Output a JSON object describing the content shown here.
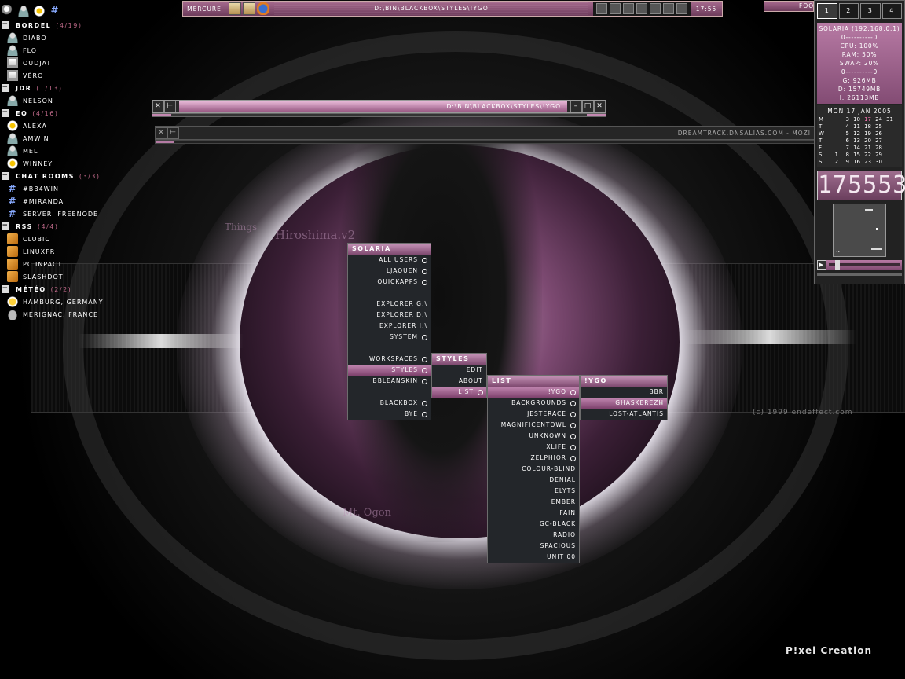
{
  "contacts": {
    "groups": [
      {
        "name": "BORDEL",
        "count": "(4/19)",
        "items": [
          {
            "name": "DIABO",
            "icon": "user-icon"
          },
          {
            "name": "FLO",
            "icon": "user-icon"
          },
          {
            "name": "OUDJAT",
            "icon": "computer-icon"
          },
          {
            "name": "VÉRO",
            "icon": "computer-icon"
          }
        ]
      },
      {
        "name": "JDR",
        "count": "(1/13)",
        "items": [
          {
            "name": "NELSON",
            "icon": "user-icon"
          }
        ]
      },
      {
        "name": "EQ",
        "count": "(4/16)",
        "items": [
          {
            "name": "ALEXA",
            "icon": "flower-icon"
          },
          {
            "name": "AMWIN",
            "icon": "user-icon"
          },
          {
            "name": "MEL",
            "icon": "user-icon"
          },
          {
            "name": "WINNEY",
            "icon": "flower-icon"
          }
        ]
      },
      {
        "name": "CHAT ROOMS",
        "count": "(3/3)",
        "items": [
          {
            "name": "#BB4WIN",
            "icon": "hash-icon"
          },
          {
            "name": "#MIRANDA",
            "icon": "hash-icon"
          },
          {
            "name": "SERVER: FREENODE",
            "icon": "hash-icon"
          }
        ]
      },
      {
        "name": "RSS",
        "count": "(4/4)",
        "items": [
          {
            "name": "CLUBIC",
            "icon": "rss-icon"
          },
          {
            "name": "LINUXFR",
            "icon": "rss-icon"
          },
          {
            "name": "PC INPACT",
            "icon": "rss-icon"
          },
          {
            "name": "SLASHDOT",
            "icon": "rss-icon"
          }
        ]
      },
      {
        "name": "MÉTÉO",
        "count": "(2/2)",
        "items": [
          {
            "name": "HAMBURG, GERMANY",
            "icon": "sun-icon"
          },
          {
            "name": "MERIGNAC, FRANCE",
            "icon": "cloud-icon"
          }
        ]
      }
    ]
  },
  "topbar": {
    "workspace": "MERCURE",
    "title": "D:\\BIN\\BLACKBOX\\STYLES\\!YGO",
    "clock": "17:55"
  },
  "foo_label": "FOO",
  "window1": {
    "title": "D:\\BIN\\BLACKBOX\\STYLES\\!YGO"
  },
  "window2": {
    "title": "DREAMTRACK.DNSALIAS.COM - MOZI"
  },
  "menus": {
    "solaria": {
      "title": "SOLARIA",
      "items": [
        {
          "label": "ALL USERS",
          "type": "bul"
        },
        {
          "label": "LJAOUEN",
          "type": "bul"
        },
        {
          "label": "QUICKAPPS",
          "type": "bul"
        },
        {
          "label": "",
          "type": "gap"
        },
        {
          "label": "EXPLORER G:\\",
          "type": "plain"
        },
        {
          "label": "EXPLORER D:\\",
          "type": "plain"
        },
        {
          "label": "EXPLORER I:\\",
          "type": "plain"
        },
        {
          "label": "SYSTEM",
          "type": "bul"
        },
        {
          "label": "",
          "type": "gap"
        },
        {
          "label": "WORKSPACES",
          "type": "bul"
        },
        {
          "label": "STYLES",
          "type": "bul sel"
        },
        {
          "label": "BBLEANSKIN",
          "type": "bul"
        },
        {
          "label": "",
          "type": "gap"
        },
        {
          "label": "BLACKBOX",
          "type": "bul"
        },
        {
          "label": "BYE",
          "type": "bul"
        }
      ]
    },
    "styles": {
      "title": "STYLES",
      "items": [
        {
          "label": "EDIT",
          "type": "plain"
        },
        {
          "label": "ABOUT",
          "type": "plain"
        },
        {
          "label": "LIST",
          "type": "bul sel"
        }
      ]
    },
    "list": {
      "title": "LIST",
      "items": [
        {
          "label": "!YGO",
          "type": "bul sel"
        },
        {
          "label": "BACKGROUNDS",
          "type": "bul"
        },
        {
          "label": "JESTERACE",
          "type": "bul"
        },
        {
          "label": "MAGNIFICENTOWL",
          "type": "bul"
        },
        {
          "label": "UNKNOWN",
          "type": "bul"
        },
        {
          "label": "XLIFE",
          "type": "bul"
        },
        {
          "label": "ZELPHIOR",
          "type": "bul"
        },
        {
          "label": "COLOUR-BLIND",
          "type": "plain"
        },
        {
          "label": "DENIAL",
          "type": "plain"
        },
        {
          "label": "ELYTS",
          "type": "plain"
        },
        {
          "label": "EMBER",
          "type": "plain"
        },
        {
          "label": "FAIN",
          "type": "plain"
        },
        {
          "label": "GC-BLACK",
          "type": "plain"
        },
        {
          "label": "RADIO",
          "type": "plain"
        },
        {
          "label": "SPACIOUS",
          "type": "plain"
        },
        {
          "label": "UNIT 00",
          "type": "plain"
        }
      ]
    },
    "ygo": {
      "title": "!YGO",
      "items": [
        {
          "label": "BBR",
          "type": "plain"
        },
        {
          "label": "GHASKEREZH",
          "type": "sel sub"
        },
        {
          "label": "LOST-ATLANTIS",
          "type": "plain"
        }
      ]
    }
  },
  "panel": {
    "workspaces": [
      "1",
      "2",
      "3",
      "4"
    ],
    "active_workspace": 0,
    "sys": [
      "SOLARIA (192.168.0.1)",
      "0----------0",
      "CPU: 100%",
      "RAM: 50%",
      "SWAP: 20%",
      "0----------0",
      "G: 926MB",
      "D: 15749MB",
      "I: 26113MB"
    ],
    "calendar_header": "MON 17 JAN 2005",
    "calendar_rows": [
      {
        "day": "M",
        "dates": [
          "",
          "3",
          "10",
          "17",
          "24",
          "31"
        ]
      },
      {
        "day": "T",
        "dates": [
          "",
          "4",
          "11",
          "18",
          "25",
          ""
        ]
      },
      {
        "day": "W",
        "dates": [
          "",
          "5",
          "12",
          "19",
          "26",
          ""
        ]
      },
      {
        "day": "T",
        "dates": [
          "",
          "6",
          "13",
          "20",
          "27",
          ""
        ]
      },
      {
        "day": "F",
        "dates": [
          "",
          "7",
          "14",
          "21",
          "28",
          ""
        ]
      },
      {
        "day": "S",
        "dates": [
          "1",
          "8",
          "15",
          "22",
          "29",
          ""
        ]
      },
      {
        "day": "S",
        "dates": [
          "2",
          "9",
          "16",
          "23",
          "30",
          ""
        ]
      }
    ],
    "today": "17",
    "lcd_time": "175553",
    "pong_score": "...",
    "player_button": "▶"
  },
  "wallpaper": {
    "texts": [
      "Hiroshima.v2",
      "Mt. Ogon",
      "Things"
    ],
    "copyright": "(c) 1999 endeffect.com",
    "signature": "P!xel Creation"
  },
  "colors": {
    "accent": "#a66a8e",
    "accent_dark": "#6e3c5c",
    "menu_bg": "#23262a",
    "group_count": "#c06a8a"
  }
}
